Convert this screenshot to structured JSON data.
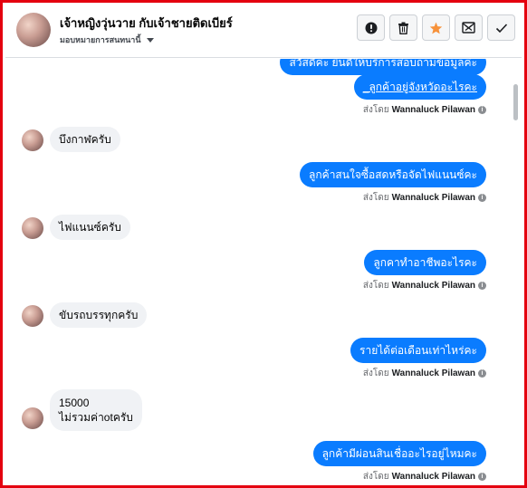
{
  "header": {
    "title": "เจ้าหญิงวุ่นวาย กับเจ้าชายติดเบียร์",
    "assign_label": "มอบหมายการสนทนานี้",
    "actions": [
      {
        "name": "report-spam-button",
        "icon": "exclamation-icon"
      },
      {
        "name": "delete-button",
        "icon": "trash-icon"
      },
      {
        "name": "star-button",
        "icon": "star-icon",
        "color": "#f7923b"
      },
      {
        "name": "mark-unread-button",
        "icon": "envelope-x-icon"
      },
      {
        "name": "mark-done-button",
        "icon": "check-icon"
      }
    ]
  },
  "sent_by_label": "ส่งโดย",
  "sender_name": "Wannaluck Pilawan",
  "info_icon": "i",
  "messages": {
    "m0": {
      "text": "สวัสดีค่ะ ยินดีให้บริการสอบถามข้อมูลค่ะ"
    },
    "m1": {
      "text": "_ลูกค้าอยู่จังหวัดอะไรคะ"
    },
    "m2": {
      "text": "บึงกาฬครับ"
    },
    "m3": {
      "text": "ลูกค้าสนใจซื้อสดหรือจัดไฟแนนซ์คะ"
    },
    "m4": {
      "text": "ไฟแนนซ์ครับ"
    },
    "m5": {
      "text": "ลูกคาทำอาชีพอะไรคะ"
    },
    "m6": {
      "text": "ขับรถบรรทุกครับ"
    },
    "m7": {
      "text": "รายได้ต่อเดือนเท่าไหร่คะ"
    },
    "m8": {
      "line1": "15000",
      "line2": "ไม่รวมค่าotครับ"
    },
    "m9": {
      "text": "ลูกค้ามีผ่อนสินเชื่ออะไรอยู่ไหมคะ"
    }
  },
  "colors": {
    "accent": "#0a7cff",
    "incoming_bubble": "#f0f2f5",
    "frame": "#e4000f"
  }
}
